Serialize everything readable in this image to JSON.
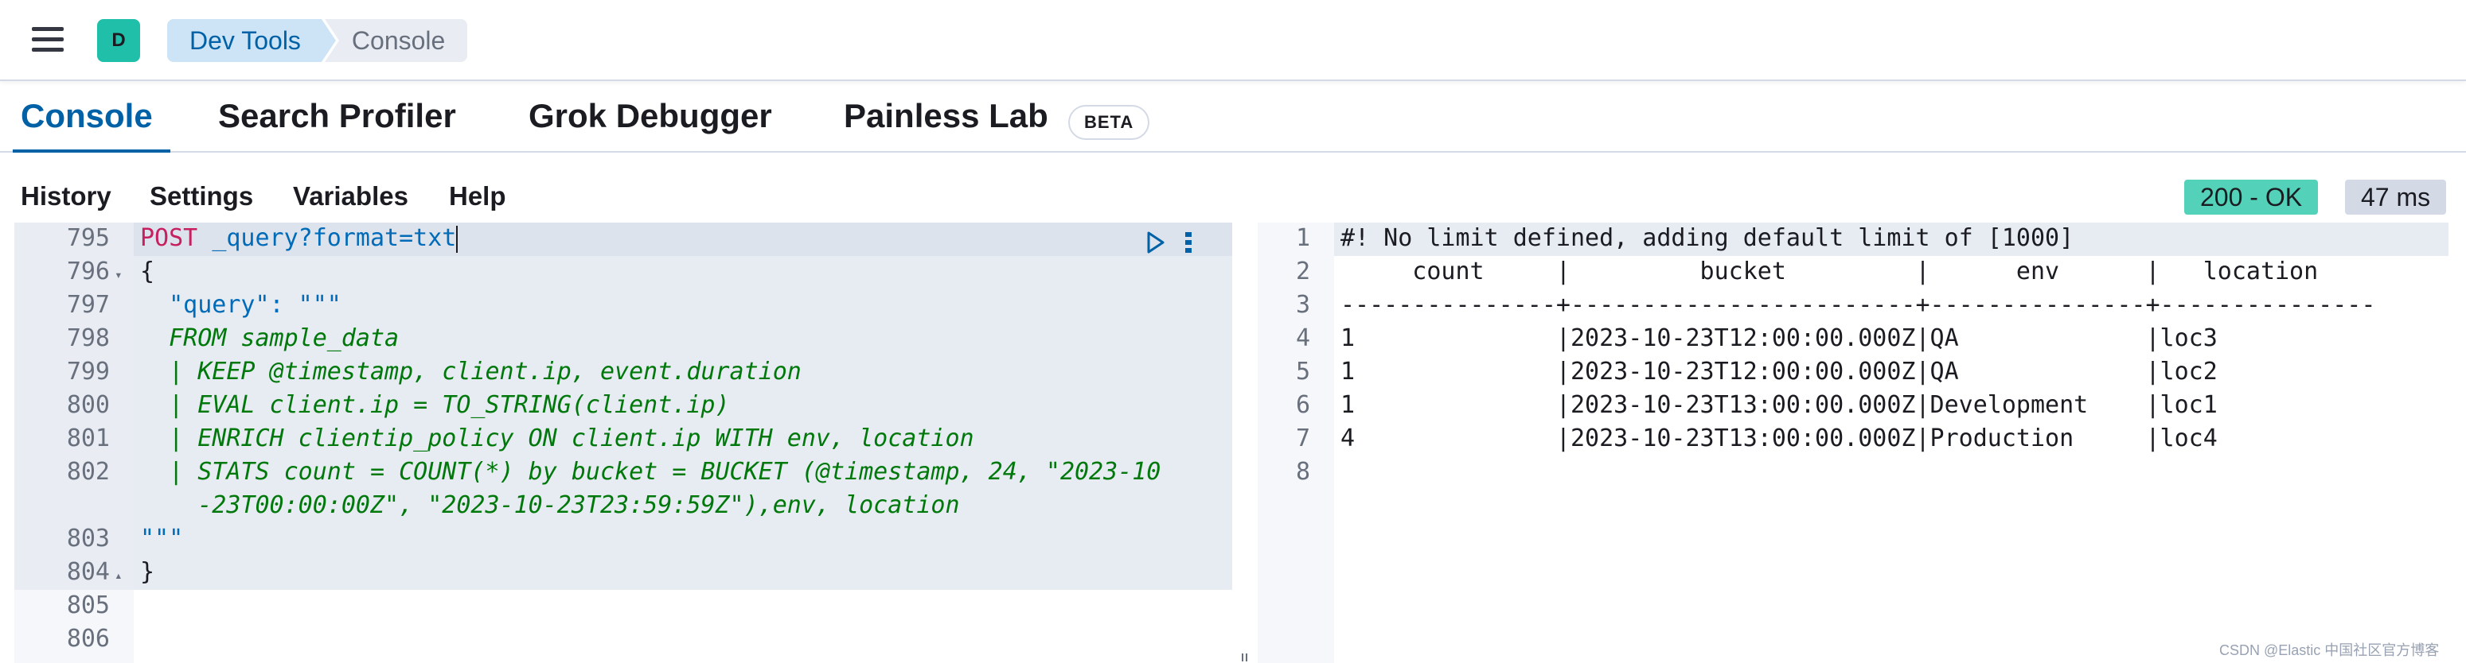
{
  "header": {
    "avatar_letter": "D",
    "breadcrumbs": [
      "Dev Tools",
      "Console"
    ]
  },
  "tabs": [
    {
      "label": "Console",
      "active": true
    },
    {
      "label": "Search Profiler"
    },
    {
      "label": "Grok Debugger"
    },
    {
      "label": "Painless Lab",
      "badge": "BETA"
    }
  ],
  "menu": [
    "History",
    "Settings",
    "Variables",
    "Help"
  ],
  "response": {
    "status": "200 - OK",
    "time": "47 ms"
  },
  "request_editor": {
    "line_numbers": [
      "795",
      "796",
      "797",
      "798",
      "799",
      "800",
      "801",
      "802",
      "",
      "803",
      "804",
      "805",
      "806"
    ],
    "method": "POST",
    "path": "_query?format=txt",
    "lines": [
      "{",
      "  \"query\": \"\"\"",
      "  FROM sample_data",
      "  | KEEP @timestamp, client.ip, event.duration",
      "  | EVAL client.ip = TO_STRING(client.ip)",
      "  | ENRICH clientip_policy ON client.ip WITH env, location",
      "  | STATS count = COUNT(*) by bucket = BUCKET (@timestamp, 24, \"2023-10",
      "    -23T00:00:00Z\", \"2023-10-23T23:59:59Z\"),env, location",
      "\"\"\"",
      "}"
    ]
  },
  "response_editor": {
    "line_numbers": [
      "1",
      "2",
      "3",
      "4",
      "5",
      "6",
      "7",
      "8"
    ],
    "lines": [
      "#! No limit defined, adding default limit of [1000]",
      "     count     |         bucket         |      env      |   location    ",
      "---------------+------------------------+---------------+---------------",
      "1              |2023-10-23T12:00:00.000Z|QA             |loc3           ",
      "1              |2023-10-23T12:00:00.000Z|QA             |loc2           ",
      "1              |2023-10-23T13:00:00.000Z|Development    |loc1           ",
      "4              |2023-10-23T13:00:00.000Z|Production     |loc4           ",
      ""
    ]
  },
  "watermark": "CSDN @Elastic 中国社区官方博客"
}
